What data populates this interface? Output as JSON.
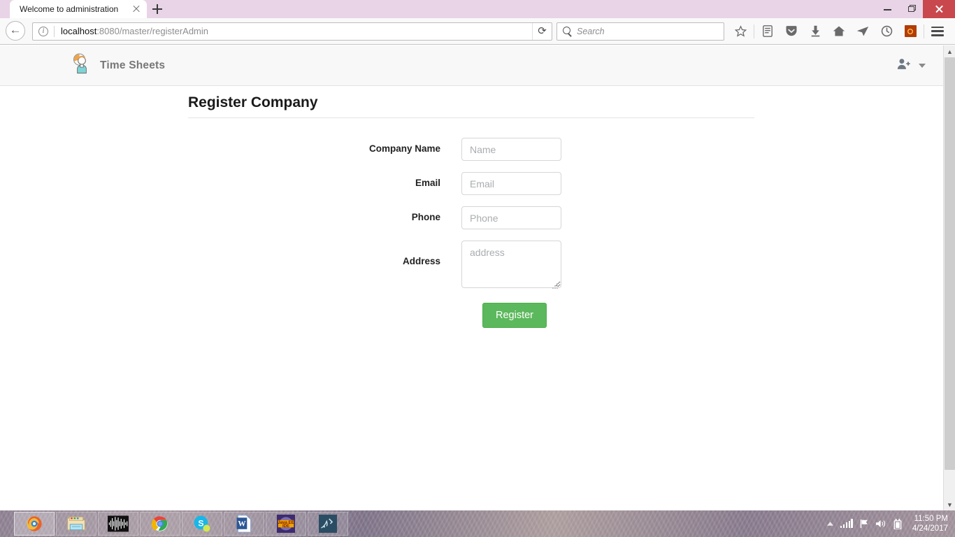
{
  "browser": {
    "tab": {
      "title": "Welcome to administration",
      "close_label": "x"
    },
    "new_tab_label": "+",
    "url": {
      "host": "localhost",
      "rest": ":8080/master/registerAdmin"
    },
    "search": {
      "placeholder": "Search"
    },
    "window_controls": {
      "minimize": "minimize",
      "restore": "restore",
      "close": "close"
    },
    "toolbar_icons": [
      "bookmark-star-icon",
      "library-icon",
      "pocket-icon",
      "downloads-icon",
      "home-icon",
      "send-tab-icon",
      "sync-history-icon",
      "addon-badge-icon",
      "menu-icon"
    ],
    "nav_icons": [
      "back-icon",
      "identity-info-icon",
      "reload-icon",
      "search-icon"
    ]
  },
  "app": {
    "brand": "Time Sheets",
    "logo_icon": "user-clock-logo",
    "user_menu_icon": "user-add-icon",
    "user_menu_caret": "chevron-down-icon"
  },
  "page": {
    "title": "Register Company",
    "fields": [
      {
        "label": "Company Name",
        "placeholder": "Name",
        "value": "",
        "type": "text",
        "name": "company-name"
      },
      {
        "label": "Email",
        "placeholder": "Email",
        "value": "",
        "type": "text",
        "name": "email"
      },
      {
        "label": "Phone",
        "placeholder": "Phone",
        "value": "",
        "type": "text",
        "name": "phone"
      },
      {
        "label": "Address",
        "placeholder": "address",
        "value": "",
        "type": "textarea",
        "name": "address"
      }
    ],
    "submit_label": "Register",
    "accent_color": "#5cb85c"
  },
  "scrollbar": {
    "up": "scroll-up",
    "down": "scroll-down"
  },
  "taskbar": {
    "apps": [
      {
        "name": "firefox",
        "active": true
      },
      {
        "name": "file-explorer",
        "active": false
      },
      {
        "name": "audio-editor",
        "active": false
      },
      {
        "name": "chrome",
        "active": false
      },
      {
        "name": "skype",
        "active": false
      },
      {
        "name": "word",
        "active": false
      },
      {
        "name": "java-ee-ide",
        "active": false
      },
      {
        "name": "mysql-workbench",
        "active": false
      }
    ],
    "tray_icons": [
      "show-hidden-icons",
      "network-signal-icon",
      "flag-notification-icon",
      "volume-icon",
      "battery-icon"
    ],
    "time": "11:50 PM",
    "date": "4/24/2017"
  }
}
